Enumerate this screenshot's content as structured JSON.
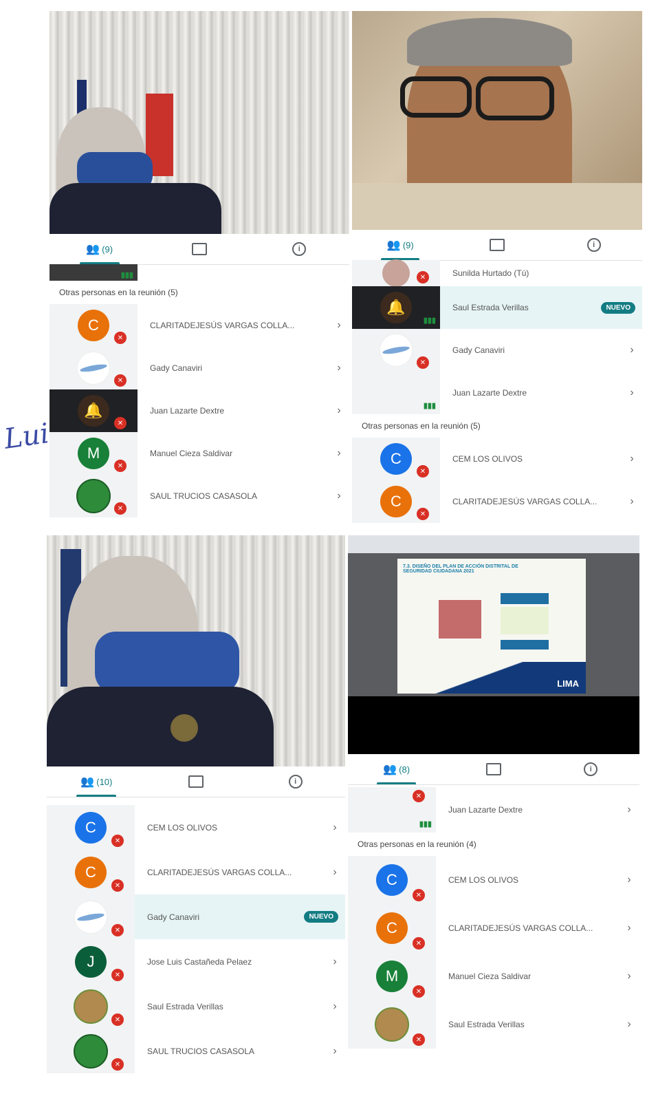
{
  "signature_text": "Luis",
  "panels": {
    "tl": {
      "tabs": {
        "people_count": "(9)",
        "chat": "chat-icon",
        "info": "info-icon"
      },
      "section": "Otras personas en la reunión (5)",
      "rows": [
        {
          "name": "CLARITADEJESÚS VARGAS COLLA...",
          "avatar": "C",
          "color": "#e8710a"
        },
        {
          "name": "Gady Canaviri",
          "avatar": "",
          "color": "#ffffff"
        },
        {
          "name": "Juan Lazarte Dextre",
          "avatar": "",
          "color": "#202124"
        },
        {
          "name": "Manuel Cieza Saldivar",
          "avatar": "M",
          "color": "#188038"
        },
        {
          "name": "SAUL TRUCIOS CASASOLA",
          "avatar": "",
          "color": "#2e8b3a"
        }
      ]
    },
    "tr": {
      "tabs": {
        "people_count": "(9)"
      },
      "top_rows": [
        {
          "name": "Sunilda Hurtado (Tú)"
        },
        {
          "name": "Saul Estrada Verillas",
          "badge": "NUEVO"
        },
        {
          "name": "Gady Canaviri"
        },
        {
          "name": "Juan Lazarte Dextre"
        }
      ],
      "section": "Otras personas en la reunión (5)",
      "rows": [
        {
          "name": "CEM LOS OLIVOS",
          "avatar": "C",
          "color": "#1a73e8"
        },
        {
          "name": "CLARITADEJESÚS VARGAS COLLA...",
          "avatar": "C",
          "color": "#e8710a"
        }
      ]
    },
    "bl": {
      "tabs": {
        "people_count": "(10)"
      },
      "rows": [
        {
          "name": "CEM LOS OLIVOS",
          "avatar": "C",
          "color": "#1a73e8"
        },
        {
          "name": "CLARITADEJESÚS VARGAS COLLA...",
          "avatar": "C",
          "color": "#e8710a"
        },
        {
          "name": "Gady Canaviri",
          "avatar": "",
          "color": "#ffffff",
          "badge": "NUEVO"
        },
        {
          "name": "Jose Luis Castañeda Pelaez",
          "avatar": "J",
          "color": "#0b5e3a"
        },
        {
          "name": "Saul Estrada Verillas",
          "avatar": "",
          "color": "#b08a4e"
        },
        {
          "name": "SAUL TRUCIOS CASASOLA",
          "avatar": "",
          "color": "#2e8b3a"
        }
      ]
    },
    "br": {
      "slide": {
        "title": "7.3. DISEÑO DEL PLAN DE ACCIÓN DISTRITAL DE SEGURIDAD CIUDADANA 2021",
        "logo": "LIMA"
      },
      "tabs": {
        "people_count": "(8)"
      },
      "top_rows": [
        {
          "name": "Juan Lazarte Dextre"
        }
      ],
      "section": "Otras personas en la reunión (4)",
      "rows": [
        {
          "name": "CEM LOS OLIVOS",
          "avatar": "C",
          "color": "#1a73e8"
        },
        {
          "name": "CLARITADEJESÚS VARGAS COLLA...",
          "avatar": "C",
          "color": "#e8710a"
        },
        {
          "name": "Manuel Cieza Saldivar",
          "avatar": "M",
          "color": "#188038"
        },
        {
          "name": "Saul Estrada Verillas",
          "avatar": "",
          "color": "#b08a4e"
        }
      ]
    }
  },
  "icons": {
    "people": "people-icon",
    "chat": "chat-icon",
    "info": "info-icon",
    "chevron": "chevron-right-icon",
    "mic_off": "mic-off-icon"
  }
}
